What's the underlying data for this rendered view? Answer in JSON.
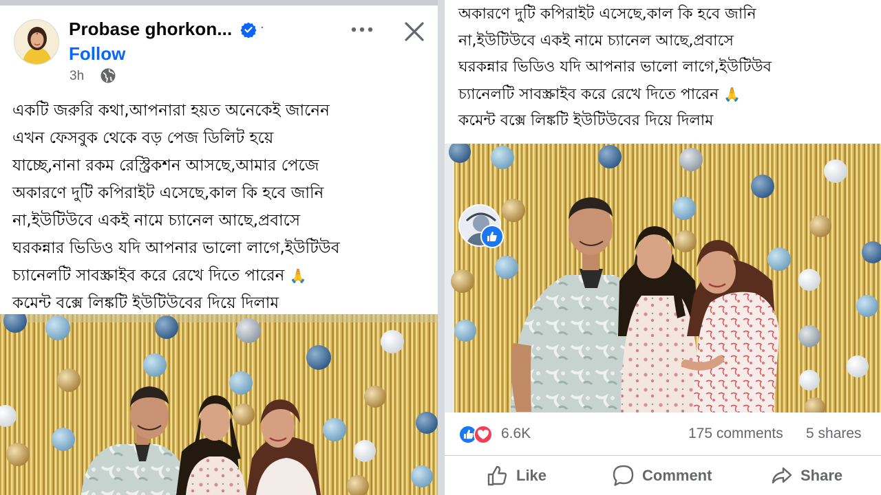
{
  "post": {
    "author": "Probase ghorkon...",
    "follow_label": "Follow",
    "time": "3h",
    "text_lines": [
      "একটি জরুরি কথা,আপনারা হয়ত অনেকেই জানেন",
      "এখন ফেসবুক থেকে বড় পেজ ডিলিট হয়ে",
      "যাচ্ছে,নানা রকম রেস্ট্রিকশন আসছে,আমার পেজে",
      "অকারণে দুটি কপিরাইট এসেছে,কাল কি হবে জানি",
      "না,ইউটিউবে একই নামে চ্যানেল আছে,প্রবাসে",
      "ঘরকন্নার ভিডিও যদি আপনার ভালো লাগে,ইউটিউব",
      "চ্যানেলটি সাবস্ক্রাইব করে রেখে দিতে পারেন",
      "কমেন্ট বক্সে লিঙ্কটি ইউটিউবের দিয়ে দিলাম"
    ],
    "emoji": "🙏"
  },
  "stats": {
    "reactions": "6.6K",
    "comments": "175 comments",
    "shares": "5 shares"
  },
  "actions": {
    "like": "Like",
    "comment": "Comment",
    "share": "Share"
  },
  "icons": {
    "verified": "verified-badge-icon",
    "globe": "globe-icon",
    "more": "more-options-icon",
    "close": "close-icon",
    "like": "thumbs-up-icon",
    "love": "heart-icon",
    "comment": "comment-bubble-icon",
    "share": "share-arrow-icon"
  },
  "colors": {
    "brand_blue": "#0866ff",
    "secondary_text": "#65676b",
    "love_red": "#f33e58",
    "curtain_gold": "#d4b04a"
  }
}
